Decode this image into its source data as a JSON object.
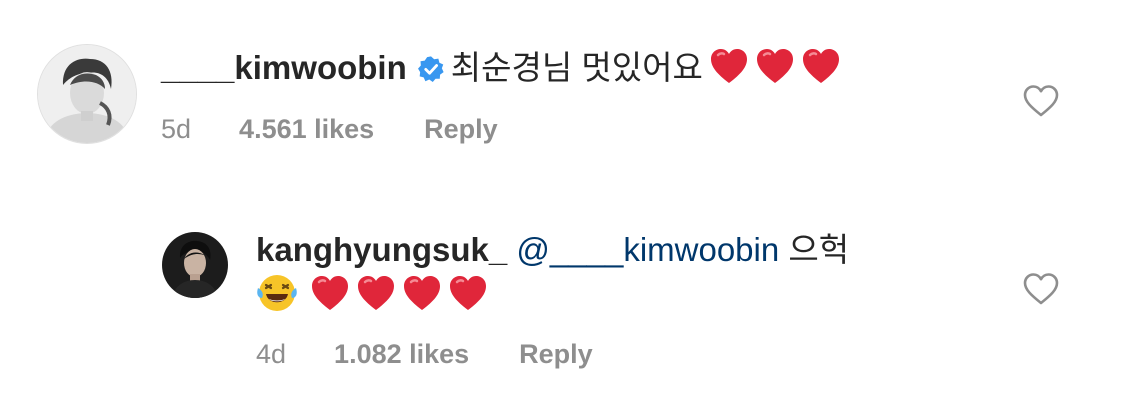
{
  "comments": [
    {
      "username": "____kimwoobin",
      "verified": true,
      "text": "최순경님 멋있어요",
      "age": "5d",
      "likes": "4.561 likes",
      "reply": "Reply"
    },
    {
      "username": "kanghyungsuk_",
      "mention": "@____kimwoobin",
      "text": "으헉",
      "age": "4d",
      "likes": "1.082 likes",
      "reply": "Reply"
    }
  ],
  "colors": {
    "text": "#262626",
    "meta": "#8e8e8e",
    "mention": "#00376b",
    "verified": "#3897f0",
    "heart": "#e0263a"
  },
  "icons": [
    "verified-badge-icon",
    "red-heart-emoji",
    "laughing-tears-emoji",
    "like-heart-outline-icon"
  ]
}
